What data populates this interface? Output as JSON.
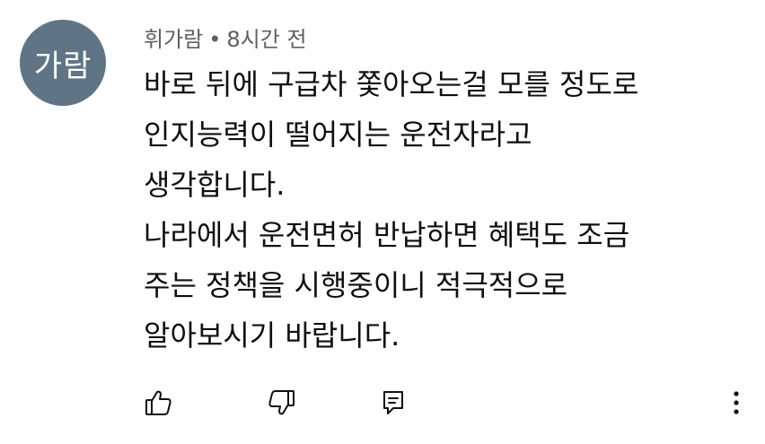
{
  "avatar": {
    "text": "가람",
    "color": "#5f7586"
  },
  "comment": {
    "author": "휘가람",
    "separator": "•",
    "time": "8시간 전",
    "lines": [
      "바로 뒤에 구급차 쫓아오는걸 모를 정도로",
      "인지능력이 떨어지는 운전자라고",
      "생각합니다.",
      "나라에서 운전면허 반납하면 혜택도 조금",
      "주는 정책을 시행중이니 적극적으로",
      "알아보시기 바랍니다."
    ]
  },
  "actions": {
    "like_icon": "thumbs-up-icon",
    "dislike_icon": "thumbs-down-icon",
    "reply_icon": "reply-icon",
    "more_icon": "more-vertical-icon"
  }
}
